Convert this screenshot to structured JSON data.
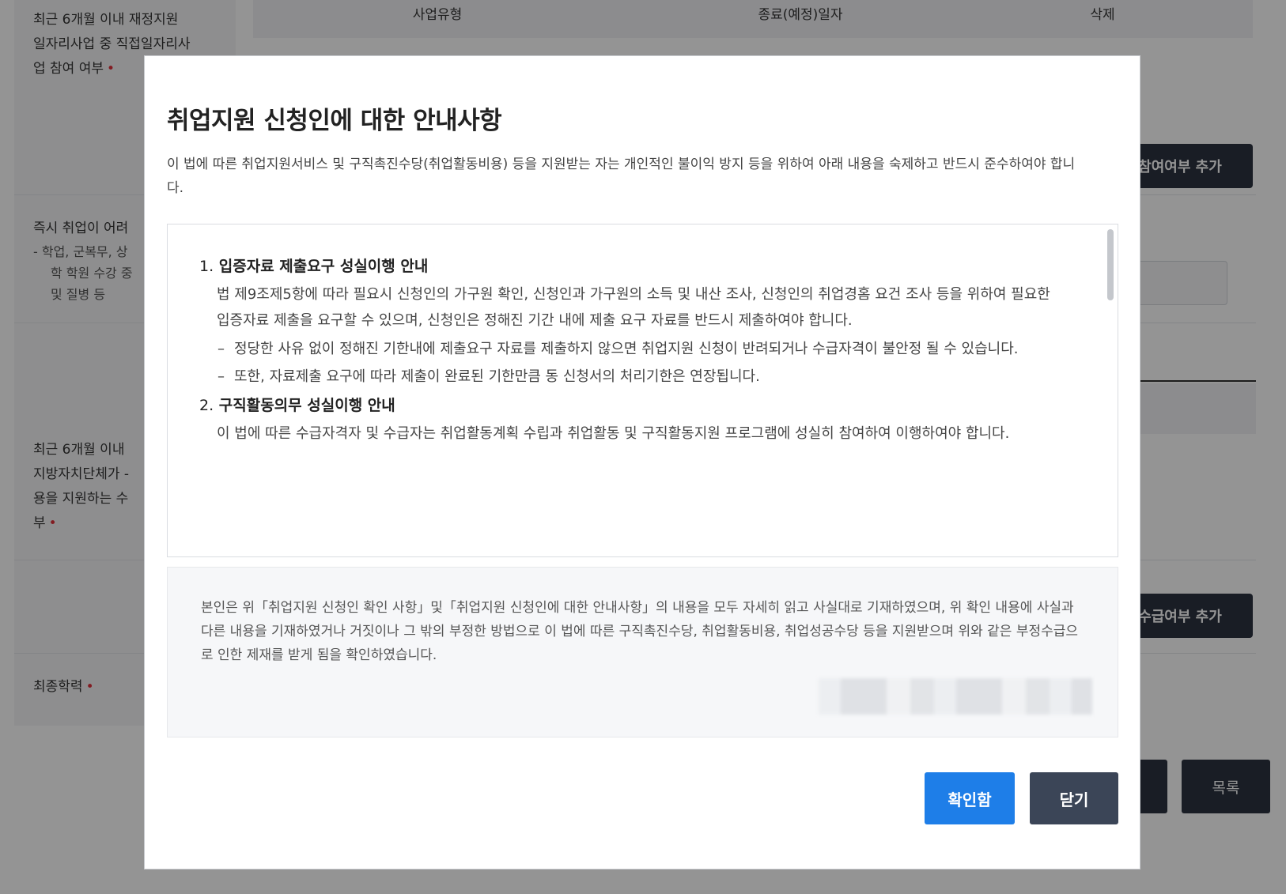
{
  "background": {
    "table_headers": [
      "사업유형",
      "종료(예정)일자",
      "삭제"
    ],
    "rows": [
      {
        "label_lines": [
          "최근 6개월 이내 재정지원",
          "일자리사업 중 직접일자리사",
          "업 참여 여부"
        ],
        "required": true
      },
      {
        "label_lines": [
          "즉시 취업이 어려"
        ],
        "sub_lines": [
          "- 학업, 군복무, 상",
          "학 학원 수강 중",
          "및 질병 등"
        ],
        "required": false
      },
      {
        "label_lines": [
          "최근 6개월 이내",
          "지방자치단체가 -",
          "용을 지원하는 수",
          "부"
        ],
        "required": true
      },
      {
        "label_lines": [
          "최종학력"
        ],
        "required": true
      }
    ],
    "buttons": {
      "add_participation": "참여여부 추가",
      "add_receipt": "수급여부 추가",
      "list": "목록"
    },
    "required_mark": "•"
  },
  "modal": {
    "title": "취업지원 신청인에 대한 안내사항",
    "intro": "이 법에 따른 취업지원서비스 및 구직촉진수당(취업활동비용) 등을 지원받는 자는 개인적인 불이익 방지 등을 위하여 아래 내용을 숙제하고 반드시 준수하여야 합니다.",
    "sections": [
      {
        "num": "1.",
        "heading": "입증자료 제출요구 성실이행 안내",
        "body": "법 제9조제5항에 따라 필요시 신청인의 가구원 확인, 신청인과 가구원의 소득 및 내산 조사, 신청인의 취업경홈 요건 조사 등을 위하여 필요한 입증자료 제출을 요구할 수 있으며, 신청인은 정해진 기간 내에 제출 요구 자료를 반드시 제출하여야 합니다.",
        "bullets": [
          "정당한 사유 없이 정해진 기한내에 제출요구 자료를 제출하지 않으면 취업지원 신청이 반려되거나 수급자격이 불안정 될 수 있습니다.",
          "또한, 자료제출 요구에 따라 제출이 완료된 기한만큼 동 신청서의 처리기한은 연장됩니다."
        ]
      },
      {
        "num": "2.",
        "heading": "구직활동의무 성실이행 안내",
        "body": "이 법에 따른 수급자격자 및 수급자는 취업활동계획 수립과 취업활동 및 구직활동지원 프로그램에 성실히 참여하여 이행하여야 합니다.",
        "bullets": []
      }
    ],
    "bullet_dash": "–",
    "confirm_text": "본인은 위「취업지원 신청인 확인 사항」및「취업지원 신청인에 대한 안내사항」의 내용을 모두 자세히 읽고 사실대로 기재하였으며, 위 확인 내용에 사실과 다른 내용을 기재하였거나 거짓이나 그 밖의 부정한 방법으로 이 법에 따른 구직촉진수당, 취업활동비용, 취업성공수당 등을 지원받으며 위와 같은 부정수급으로 인한 제재를 받게 됨을 확인하였습니다.",
    "buttons": {
      "confirm": "확인함",
      "close": "닫기"
    }
  },
  "colors": {
    "primary": "#1e7ee8",
    "dark_button": "#3b4557",
    "required": "#e0303a"
  }
}
